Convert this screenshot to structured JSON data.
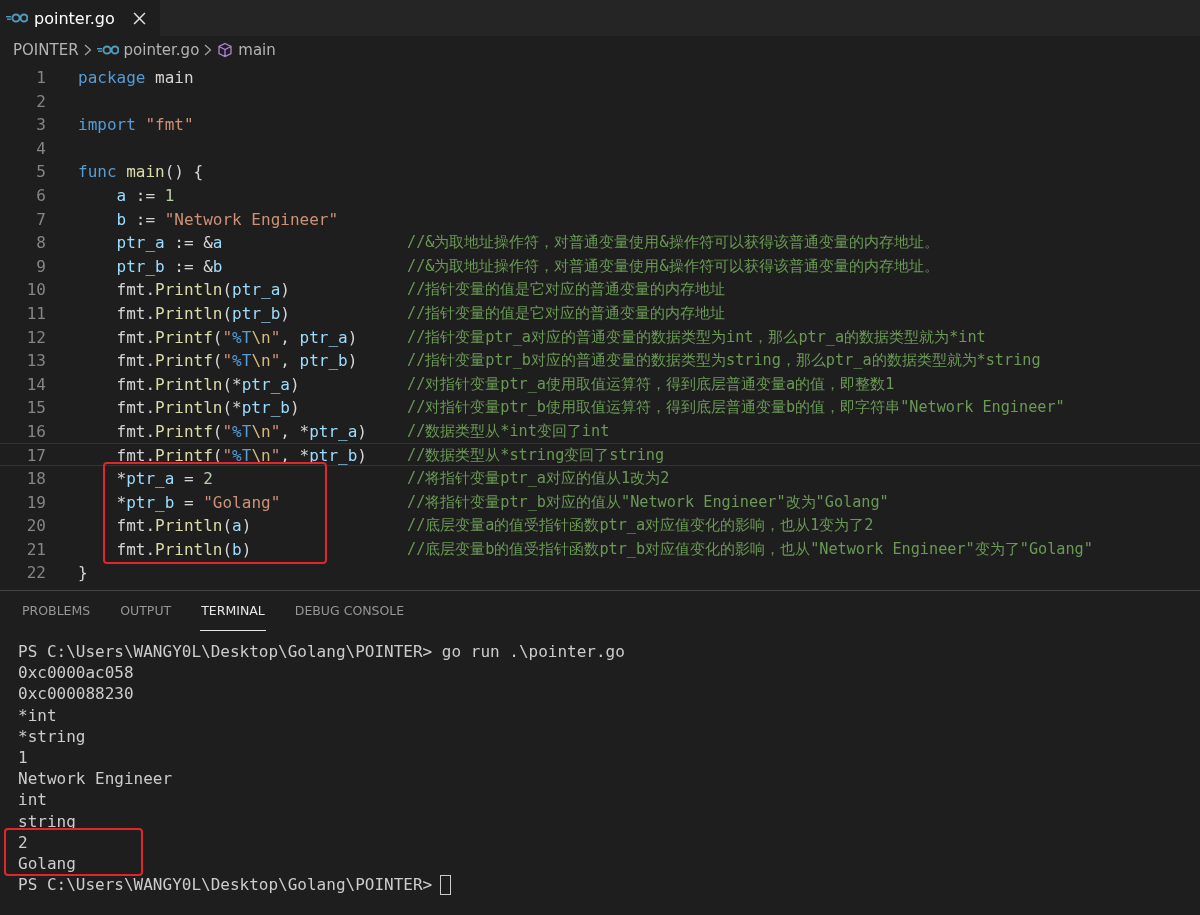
{
  "tabs": [
    {
      "label": "pointer.go",
      "selected": true
    }
  ],
  "breadcrumb": [
    {
      "kind": "folder",
      "label": "POINTER"
    },
    {
      "kind": "file",
      "label": "pointer.go"
    },
    {
      "kind": "symbol",
      "label": "main"
    }
  ],
  "editor": {
    "lines": [
      {
        "number": "1",
        "current": false,
        "boxed": false,
        "tokens": [
          {
            "kind": "keyword",
            "text": "package"
          },
          {
            "kind": "plain",
            "text": " main"
          }
        ]
      },
      {
        "number": "2",
        "current": false,
        "boxed": false
      },
      {
        "number": "3",
        "current": false,
        "boxed": false,
        "tokens": [
          {
            "kind": "keyword",
            "text": "import "
          },
          {
            "kind": "string",
            "text": "\"fmt\""
          }
        ]
      },
      {
        "number": "4",
        "current": false,
        "boxed": false
      },
      {
        "number": "5",
        "current": false,
        "boxed": false,
        "tokens": [
          {
            "kind": "keyword",
            "text": "func "
          },
          {
            "kind": "function",
            "text": "main"
          },
          {
            "kind": "plain",
            "text": "() {"
          }
        ],
        "children": [
          {
            "number": "6",
            "current": false,
            "boxed": false,
            "tokens": [
              {
                "kind": "variable",
                "text": "a"
              },
              {
                "kind": "plain",
                "text": " := "
              },
              {
                "kind": "number",
                "text": "1"
              }
            ]
          },
          {
            "number": "7",
            "current": false,
            "boxed": false,
            "tokens": [
              {
                "kind": "variable",
                "text": "b"
              },
              {
                "kind": "plain",
                "text": " := "
              },
              {
                "kind": "string",
                "text": "\"Network Engineer\""
              }
            ]
          },
          {
            "number": "8",
            "current": false,
            "boxed": false,
            "tokens": [
              {
                "kind": "variable",
                "text": "ptr_a"
              },
              {
                "kind": "plain",
                "text": " := &"
              },
              {
                "kind": "variable",
                "text": "a"
              }
            ],
            "comment": "//&为取地址操作符，对普通变量使用&操作符可以获得该普通变量的内存地址。"
          },
          {
            "number": "9",
            "current": false,
            "boxed": false,
            "tokens": [
              {
                "kind": "variable",
                "text": "ptr_b"
              },
              {
                "kind": "plain",
                "text": " := &"
              },
              {
                "kind": "variable",
                "text": "b"
              }
            ],
            "comment": "//&为取地址操作符，对普通变量使用&操作符可以获得该普通变量的内存地址。"
          },
          {
            "number": "10",
            "current": false,
            "boxed": false,
            "tokens": [
              {
                "kind": "plain",
                "text": "fmt."
              },
              {
                "kind": "function",
                "text": "Println"
              },
              {
                "kind": "plain",
                "text": "("
              },
              {
                "kind": "variable",
                "text": "ptr_a"
              },
              {
                "kind": "plain",
                "text": ")"
              }
            ],
            "comment": "//指针变量的值是它对应的普通变量的内存地址"
          },
          {
            "number": "11",
            "current": false,
            "boxed": false,
            "tokens": [
              {
                "kind": "plain",
                "text": "fmt."
              },
              {
                "kind": "function",
                "text": "Println"
              },
              {
                "kind": "plain",
                "text": "("
              },
              {
                "kind": "variable",
                "text": "ptr_b"
              },
              {
                "kind": "plain",
                "text": ")"
              }
            ],
            "comment": "//指针变量的值是它对应的普通变量的内存地址"
          },
          {
            "number": "12",
            "current": false,
            "boxed": false,
            "tokens": [
              {
                "kind": "plain",
                "text": "fmt."
              },
              {
                "kind": "function",
                "text": "Printf"
              },
              {
                "kind": "plain",
                "text": "("
              },
              {
                "kind": "string",
                "text": "\""
              },
              {
                "kind": "format",
                "text": "%T"
              },
              {
                "kind": "escape",
                "text": "\\n"
              },
              {
                "kind": "string",
                "text": "\""
              },
              {
                "kind": "plain",
                "text": ", "
              },
              {
                "kind": "variable",
                "text": "ptr_a"
              },
              {
                "kind": "plain",
                "text": ")"
              }
            ],
            "comment": "//指针变量ptr_a对应的普通变量的数据类型为int，那么ptr_a的数据类型就为*int"
          },
          {
            "number": "13",
            "current": false,
            "boxed": false,
            "tokens": [
              {
                "kind": "plain",
                "text": "fmt."
              },
              {
                "kind": "function",
                "text": "Printf"
              },
              {
                "kind": "plain",
                "text": "("
              },
              {
                "kind": "string",
                "text": "\""
              },
              {
                "kind": "format",
                "text": "%T"
              },
              {
                "kind": "escape",
                "text": "\\n"
              },
              {
                "kind": "string",
                "text": "\""
              },
              {
                "kind": "plain",
                "text": ", "
              },
              {
                "kind": "variable",
                "text": "ptr_b"
              },
              {
                "kind": "plain",
                "text": ")"
              }
            ],
            "comment": "//指针变量ptr_b对应的普通变量的数据类型为string，那么ptr_a的数据类型就为*string"
          },
          {
            "number": "14",
            "current": false,
            "boxed": false,
            "tokens": [
              {
                "kind": "plain",
                "text": "fmt."
              },
              {
                "kind": "function",
                "text": "Println"
              },
              {
                "kind": "plain",
                "text": "(*"
              },
              {
                "kind": "variable",
                "text": "ptr_a"
              },
              {
                "kind": "plain",
                "text": ")"
              }
            ],
            "comment": "//对指针变量ptr_a使用取值运算符，得到底层普通变量a的值，即整数1"
          },
          {
            "number": "15",
            "current": false,
            "boxed": false,
            "tokens": [
              {
                "kind": "plain",
                "text": "fmt."
              },
              {
                "kind": "function",
                "text": "Println"
              },
              {
                "kind": "plain",
                "text": "(*"
              },
              {
                "kind": "variable",
                "text": "ptr_b"
              },
              {
                "kind": "plain",
                "text": ")"
              }
            ],
            "comment": "//对指针变量ptr_b使用取值运算符，得到底层普通变量b的值，即字符串\"Network Engineer\""
          },
          {
            "number": "16",
            "current": false,
            "boxed": false,
            "tokens": [
              {
                "kind": "plain",
                "text": "fmt."
              },
              {
                "kind": "function",
                "text": "Printf"
              },
              {
                "kind": "plain",
                "text": "("
              },
              {
                "kind": "string",
                "text": "\""
              },
              {
                "kind": "format",
                "text": "%T"
              },
              {
                "kind": "escape",
                "text": "\\n"
              },
              {
                "kind": "string",
                "text": "\""
              },
              {
                "kind": "plain",
                "text": ", *"
              },
              {
                "kind": "variable",
                "text": "ptr_a"
              },
              {
                "kind": "plain",
                "text": ")"
              }
            ],
            "comment": "//数据类型从*int变回了int"
          },
          {
            "number": "17",
            "current": true,
            "boxed": false,
            "tokens": [
              {
                "kind": "plain",
                "text": "fmt."
              },
              {
                "kind": "function",
                "text": "Printf"
              },
              {
                "kind": "plain",
                "text": "("
              },
              {
                "kind": "string",
                "text": "\""
              },
              {
                "kind": "format",
                "text": "%T"
              },
              {
                "kind": "escape",
                "text": "\\n"
              },
              {
                "kind": "string",
                "text": "\""
              },
              {
                "kind": "plain",
                "text": ", *"
              },
              {
                "kind": "variable",
                "text": "ptr_b"
              },
              {
                "kind": "plain",
                "text": ")"
              }
            ],
            "comment": "//数据类型从*string变回了string"
          },
          {
            "number": "18",
            "current": false,
            "boxed": true,
            "tokens": [
              {
                "kind": "plain",
                "text": "*"
              },
              {
                "kind": "variable",
                "text": "ptr_a"
              },
              {
                "kind": "plain",
                "text": " = "
              },
              {
                "kind": "number",
                "text": "2"
              }
            ],
            "comment": "//将指针变量ptr_a对应的值从1改为2"
          },
          {
            "number": "19",
            "current": false,
            "boxed": true,
            "tokens": [
              {
                "kind": "plain",
                "text": "*"
              },
              {
                "kind": "variable",
                "text": "ptr_b"
              },
              {
                "kind": "plain",
                "text": " = "
              },
              {
                "kind": "string",
                "text": "\"Golang\""
              }
            ],
            "comment": "//将指针变量ptr_b对应的值从\"Network Engineer\"改为\"Golang\""
          },
          {
            "number": "20",
            "current": false,
            "boxed": true,
            "tokens": [
              {
                "kind": "plain",
                "text": "fmt."
              },
              {
                "kind": "function",
                "text": "Println"
              },
              {
                "kind": "plain",
                "text": "("
              },
              {
                "kind": "variable",
                "text": "a"
              },
              {
                "kind": "plain",
                "text": ")"
              }
            ],
            "comment": "//底层变量a的值受指针函数ptr_a对应值变化的影响，也从1变为了2"
          },
          {
            "number": "21",
            "current": false,
            "boxed": true,
            "tokens": [
              {
                "kind": "plain",
                "text": "fmt."
              },
              {
                "kind": "function",
                "text": "Println"
              },
              {
                "kind": "plain",
                "text": "("
              },
              {
                "kind": "variable",
                "text": "b"
              },
              {
                "kind": "plain",
                "text": ")"
              }
            ],
            "comment": "//底层变量b的值受指针函数ptr_b对应值变化的影响，也从\"Network Engineer\"变为了\"Golang\""
          }
        ]
      },
      {
        "number": "22",
        "current": false,
        "boxed": false,
        "tokens": [
          {
            "kind": "plain",
            "text": "}"
          }
        ]
      }
    ]
  },
  "panel": {
    "tabs": [
      {
        "label": "PROBLEMS",
        "selected": false
      },
      {
        "label": "OUTPUT",
        "selected": false
      },
      {
        "label": "TERMINAL",
        "selected": true
      },
      {
        "label": "DEBUG CONSOLE",
        "selected": false
      }
    ],
    "terminal": {
      "cursor": true,
      "lines": [
        {
          "text": "PS C:\\Users\\WANGY0L\\Desktop\\Golang\\POINTER> go run .\\pointer.go",
          "boxed": false
        },
        {
          "text": "0xc0000ac058",
          "boxed": false
        },
        {
          "text": "0xc000088230",
          "boxed": false
        },
        {
          "text": "*int",
          "boxed": false
        },
        {
          "text": "*string",
          "boxed": false
        },
        {
          "text": "1",
          "boxed": false
        },
        {
          "text": "Network Engineer",
          "boxed": false
        },
        {
          "text": "int",
          "boxed": false
        },
        {
          "text": "string",
          "boxed": false
        },
        {
          "text": "2",
          "boxed": true
        },
        {
          "text": "Golang",
          "boxed": true
        },
        {
          "text": "PS C:\\Users\\WANGY0L\\Desktop\\Golang\\POINTER>",
          "boxed": false
        }
      ]
    }
  }
}
